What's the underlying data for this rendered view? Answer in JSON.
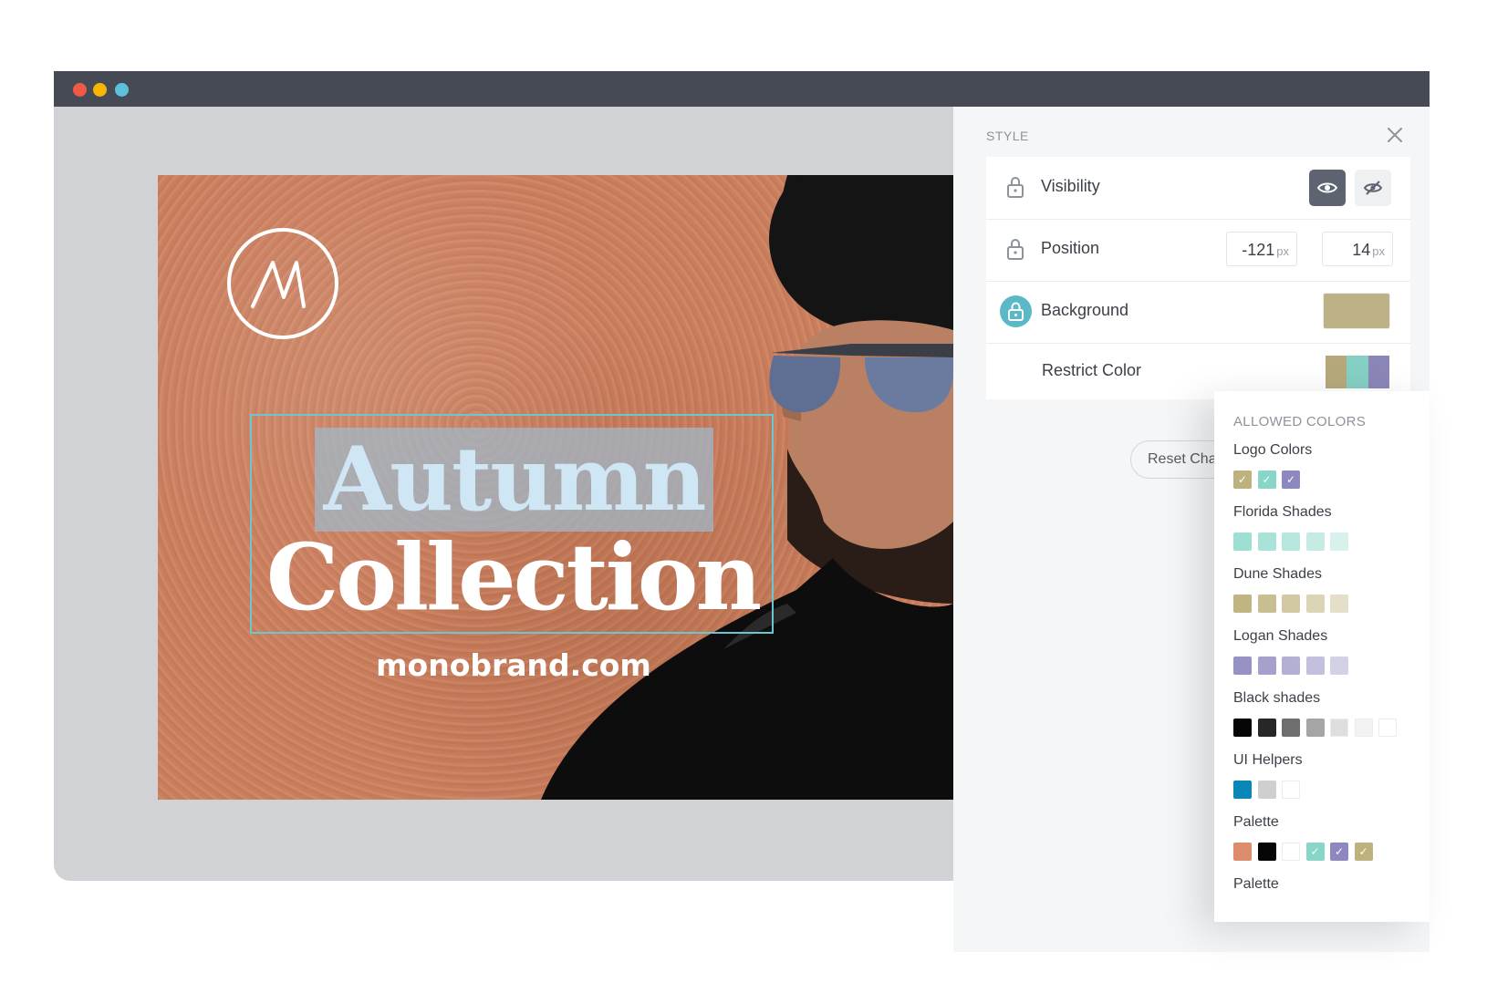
{
  "window": {
    "traffic_lights": {
      "red": "#ef5a45",
      "yellow": "#f7b500",
      "green": "#5bc0d9"
    }
  },
  "artwork": {
    "headline_line1": "Autumn",
    "headline_line2": "Collection",
    "website": "monobrand.com",
    "logo_icon": "monogram-m-logo"
  },
  "panel": {
    "title": "STYLE",
    "close_icon": "close-icon",
    "rows": {
      "visibility": {
        "label": "Visibility"
      },
      "position": {
        "label": "Position",
        "x_value": "-121",
        "y_value": "14",
        "unit": "px"
      },
      "background": {
        "label": "Background",
        "color": "#bcb286"
      },
      "restrict": {
        "label": "Restrict Color",
        "colors": [
          "#b5a97c",
          "#86cfc3",
          "#8a86b7"
        ]
      }
    },
    "reset_button_label": "Reset Cha"
  },
  "allowed_colors": {
    "title": "ALLOWED COLORS",
    "groups": [
      {
        "name": "Logo Colors",
        "colors": [
          "#bdb17e",
          "#87d6c8",
          "#8d88c0"
        ],
        "checked": [
          true,
          true,
          true
        ]
      },
      {
        "name": "Florida Shades",
        "colors": [
          "#9edfd4",
          "#a9e2d8",
          "#b6e6de",
          "#c6ebe5",
          "#d8f1ed"
        ],
        "checked": [
          false,
          false,
          false,
          false,
          false
        ]
      },
      {
        "name": "Dune Shades",
        "colors": [
          "#bfb482",
          "#c8be92",
          "#d2c9a4",
          "#dbd4b6",
          "#e5dfca"
        ],
        "checked": [
          false,
          false,
          false,
          false,
          false
        ]
      },
      {
        "name": "Logan Shades",
        "colors": [
          "#9692c4",
          "#a5a1cc",
          "#b3b0d4",
          "#c2c0dc",
          "#d2d1e6"
        ],
        "checked": [
          false,
          false,
          false,
          false,
          false
        ]
      },
      {
        "name": "Black shades",
        "colors": [
          "#050505",
          "#272727",
          "#6e6e6e",
          "#a5a5a5",
          "#dedede",
          "#f3f3f3",
          "#ffffff"
        ],
        "checked": [
          false,
          false,
          false,
          false,
          false,
          false,
          false
        ]
      },
      {
        "name": "UI Helpers",
        "colors": [
          "#0a86b8",
          "#cfcfcf",
          "#ffffff"
        ],
        "checked": [
          false,
          false,
          false
        ]
      },
      {
        "name": "Palette",
        "colors": [
          "#dc8c6a",
          "#050505",
          "#ffffff",
          "#87d6c8",
          "#8d88c0",
          "#bdb17e"
        ],
        "checked": [
          false,
          false,
          false,
          true,
          true,
          true
        ]
      },
      {
        "name": "Palette",
        "colors": [],
        "checked": []
      }
    ]
  }
}
